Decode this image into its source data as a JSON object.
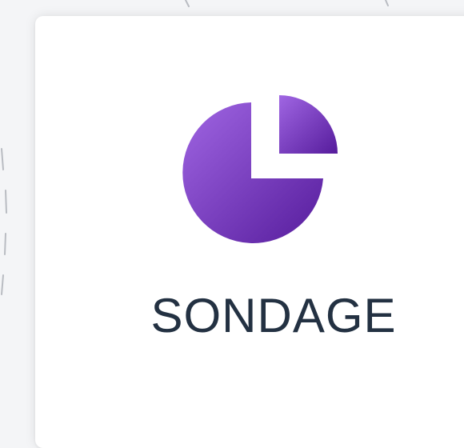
{
  "card": {
    "title": "SONDAGE",
    "icon": "pie-chart-icon"
  },
  "colors": {
    "background": "#f4f5f7",
    "card": "#ffffff",
    "title": "#233142",
    "icon_gradient_start": "#9b5fe0",
    "icon_gradient_end": "#5a1ea0",
    "dash": "#b9bcc2"
  }
}
